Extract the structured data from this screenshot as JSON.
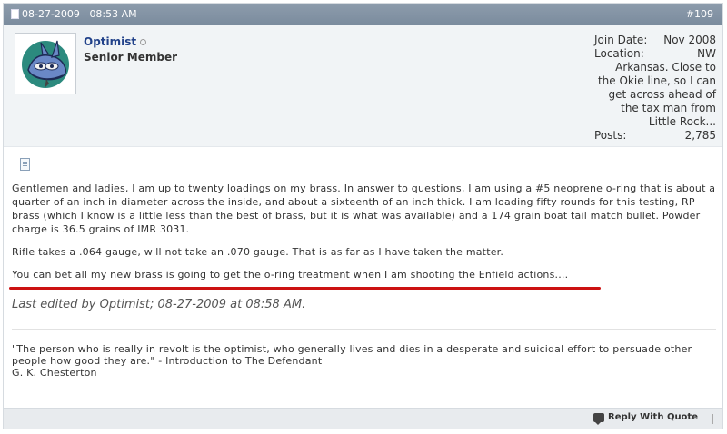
{
  "post_header": {
    "date": "08-27-2009",
    "time": "08:53 AM",
    "post_number": "#109"
  },
  "user": {
    "username": "Optimist",
    "title": "Senior Member",
    "join_date_label": "Join Date:",
    "join_date": "Nov 2008",
    "location_label": "Location:",
    "location_first": "NW",
    "location_rest": "Arkansas. Close to the Okie line, so I can get across ahead of the tax man from Little Rock...",
    "posts_label": "Posts:",
    "posts": "2,785"
  },
  "message": {
    "paragraph1": "Gentlemen and ladies, I am up to twenty loadings on my brass. In answer to questions, I am using a #5 neoprene o-ring that is about a quarter of an inch in diameter across the inside, and about a sixteenth of an inch thick. I am loading fifty rounds for this testing, RP brass (which I know is a little less than the best of brass, but it is what was available) and a 174 grain boat tail match bullet. Powder charge is 36.5 grains of IMR 3031.",
    "paragraph2": "Rifle takes a .064 gauge, will not take an .070 gauge. That is as far as I have taken the matter.",
    "paragraph3": "You can bet all my new brass is going to get the o-ring treatment when I am shooting the Enfield actions....",
    "edited": "Last edited by Optimist; 08-27-2009 at 08:58 AM."
  },
  "signature": {
    "quote": "\"The person who is really in revolt is the optimist, who generally lives and dies in a desperate and suicidal effort to persuade other people how good they are.\" - Introduction to The Defendant",
    "author": "G. K. Chesterton"
  },
  "footer": {
    "reply_label": "Reply With Quote"
  },
  "colors": {
    "header_bg": "#7f90a2",
    "username": "#22428a",
    "underline": "#cc1111"
  },
  "icons": {
    "date": "document-icon",
    "message": "document-icon",
    "reply": "speech-bubble-icon",
    "avatar": "blue-dragon-avatar"
  }
}
